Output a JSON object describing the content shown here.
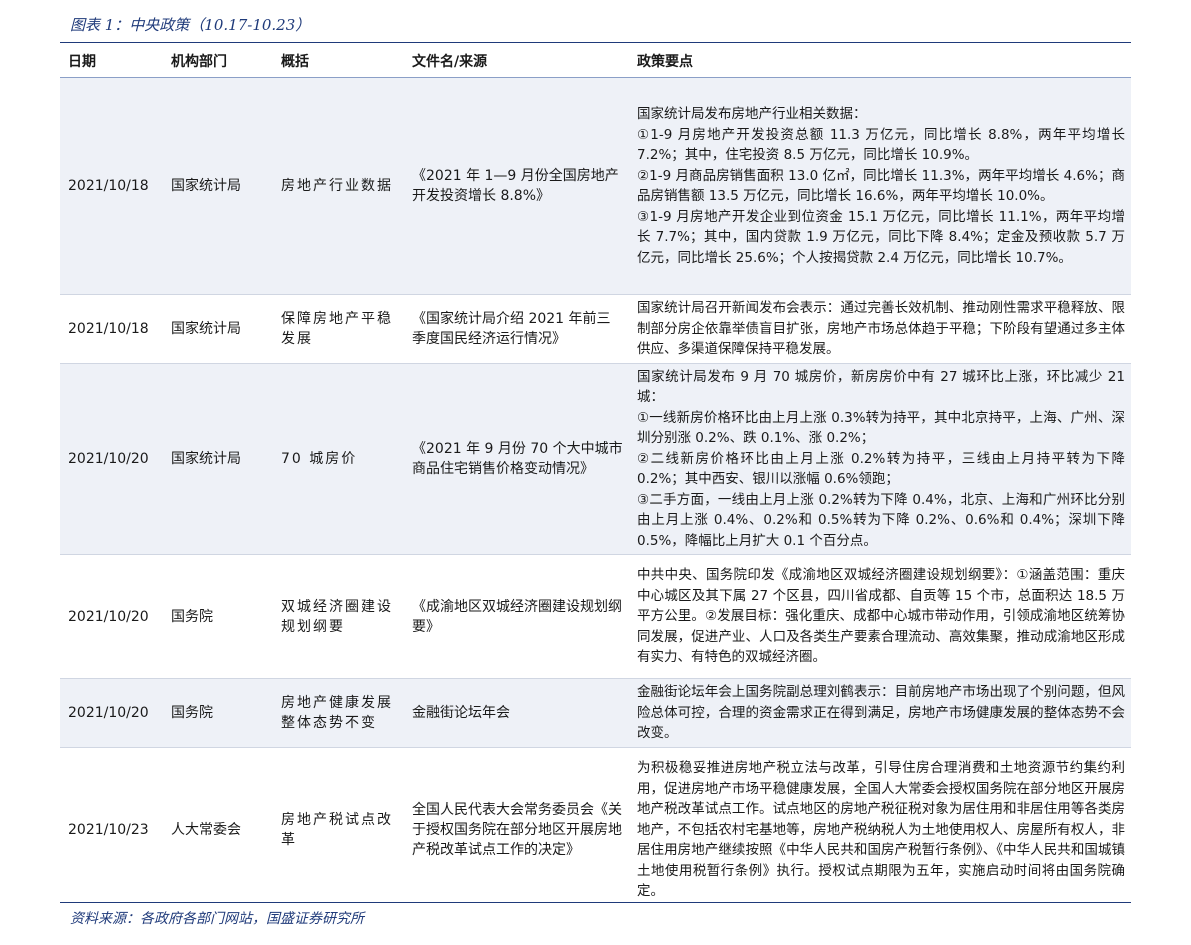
{
  "title": "图表 1：中央政策（10.17-10.23）",
  "source": "资料来源：各政府各部门网站，国盛证券研究所",
  "headers": [
    "日期",
    "机构部门",
    "概括",
    "文件名/来源",
    "政策要点"
  ],
  "rows": [
    {
      "date": "2021/10/18",
      "dept": "国家统计局",
      "summary": "房地产行业数据",
      "file": "《2021 年 1—9 月份全国房地产开发投资增长 8.8%》",
      "points": [
        "国家统计局发布房地产行业相关数据：",
        "①1-9 月房地产开发投资总额 11.3 万亿元，同比增长 8.8%，两年平均增长 7.2%；其中，住宅投资 8.5 万亿元，同比增长 10.9%。",
        "②1-9 月商品房销售面积 13.0 亿㎡，同比增长 11.3%，两年平均增长 4.6%；商品房销售额 13.5 万亿元，同比增长 16.6%，两年平均增长 10.0%。",
        "③1-9 月房地产开发企业到位资金 15.1 万亿元，同比增长 11.1%，两年平均增长 7.7%；其中，国内贷款 1.9 万亿元，同比下降 8.4%；定金及预收款 5.7 万亿元，同比增长 25.6%；个人按揭贷款 2.4 万亿元，同比增长 10.7%。"
      ]
    },
    {
      "date": "2021/10/18",
      "dept": "国家统计局",
      "summary": "保障房地产平稳发展",
      "file": "《国家统计局介绍 2021 年前三季度国民经济运行情况》",
      "points": [
        "国家统计局召开新闻发布会表示：通过完善长效机制、推动刚性需求平稳释放、限制部分房企依靠举债盲目扩张，房地产市场总体趋于平稳；下阶段有望通过多主体供应、多渠道保障保持平稳发展。"
      ]
    },
    {
      "date": "2021/10/20",
      "dept": "国家统计局",
      "summary": "70 城房价",
      "file": "《2021 年 9 月份 70 个大中城市商品住宅销售价格变动情况》",
      "points": [
        "国家统计局发布 9 月 70 城房价，新房房价中有 27 城环比上涨，环比减少 21 城：",
        "①一线新房价格环比由上月上涨 0.3%转为持平，其中北京持平，上海、广州、深圳分别涨 0.2%、跌 0.1%、涨 0.2%；",
        "②二线新房价格环比由上月上涨 0.2%转为持平，三线由上月持平转为下降 0.2%；其中西安、银川以涨幅 0.6%领跑；",
        "③二手方面，一线由上月上涨 0.2%转为下降 0.4%，北京、上海和广州环比分别由上月上涨 0.4%、0.2%和 0.5%转为下降 0.2%、0.6%和 0.4%；深圳下降 0.5%，降幅比上月扩大 0.1 个百分点。"
      ]
    },
    {
      "date": "2021/10/20",
      "dept": "国务院",
      "summary": "双城经济圈建设规划纲要",
      "file": "《成渝地区双城经济圈建设规划纲要》",
      "points": [
        "中共中央、国务院印发《成渝地区双城经济圈建设规划纲要》：①涵盖范围：重庆中心城区及其下属 27 个区县，四川省成都、自贡等 15 个市，总面积达 18.5 万平方公里。②发展目标：强化重庆、成都中心城市带动作用，引领成渝地区统筹协同发展，促进产业、人口及各类生产要素合理流动、高效集聚，推动成渝地区形成有实力、有特色的双城经济圈。"
      ]
    },
    {
      "date": "2021/10/20",
      "dept": "国务院",
      "summary": "房地产健康发展整体态势不变",
      "file": "金融街论坛年会",
      "points": [
        "金融街论坛年会上国务院副总理刘鹤表示：目前房地产市场出现了个别问题，但风险总体可控，合理的资金需求正在得到满足，房地产市场健康发展的整体态势不会改变。"
      ]
    },
    {
      "date": "2021/10/23",
      "dept": "人大常委会",
      "summary": "房地产税试点改革",
      "file": "全国人民代表大会常务委员会《关于授权国务院在部分地区开展房地产税改革试点工作的决定》",
      "points": [
        "为积极稳妥推进房地产税立法与改革，引导住房合理消费和土地资源节约集约利用，促进房地产市场平稳健康发展，全国人大常委会授权国务院在部分地区开展房地产税改革试点工作。试点地区的房地产税征税对象为居住用和非居住用等各类房地产，不包括农村宅基地等，房地产税纳税人为土地使用权人、房屋所有权人，非居住用房地产继续按照《中华人民共和国房产税暂行条例》、《中华人民共和国城镇土地使用税暂行条例》执行。授权试点期限为五年，实施启动时间将由国务院确定。"
      ]
    }
  ]
}
